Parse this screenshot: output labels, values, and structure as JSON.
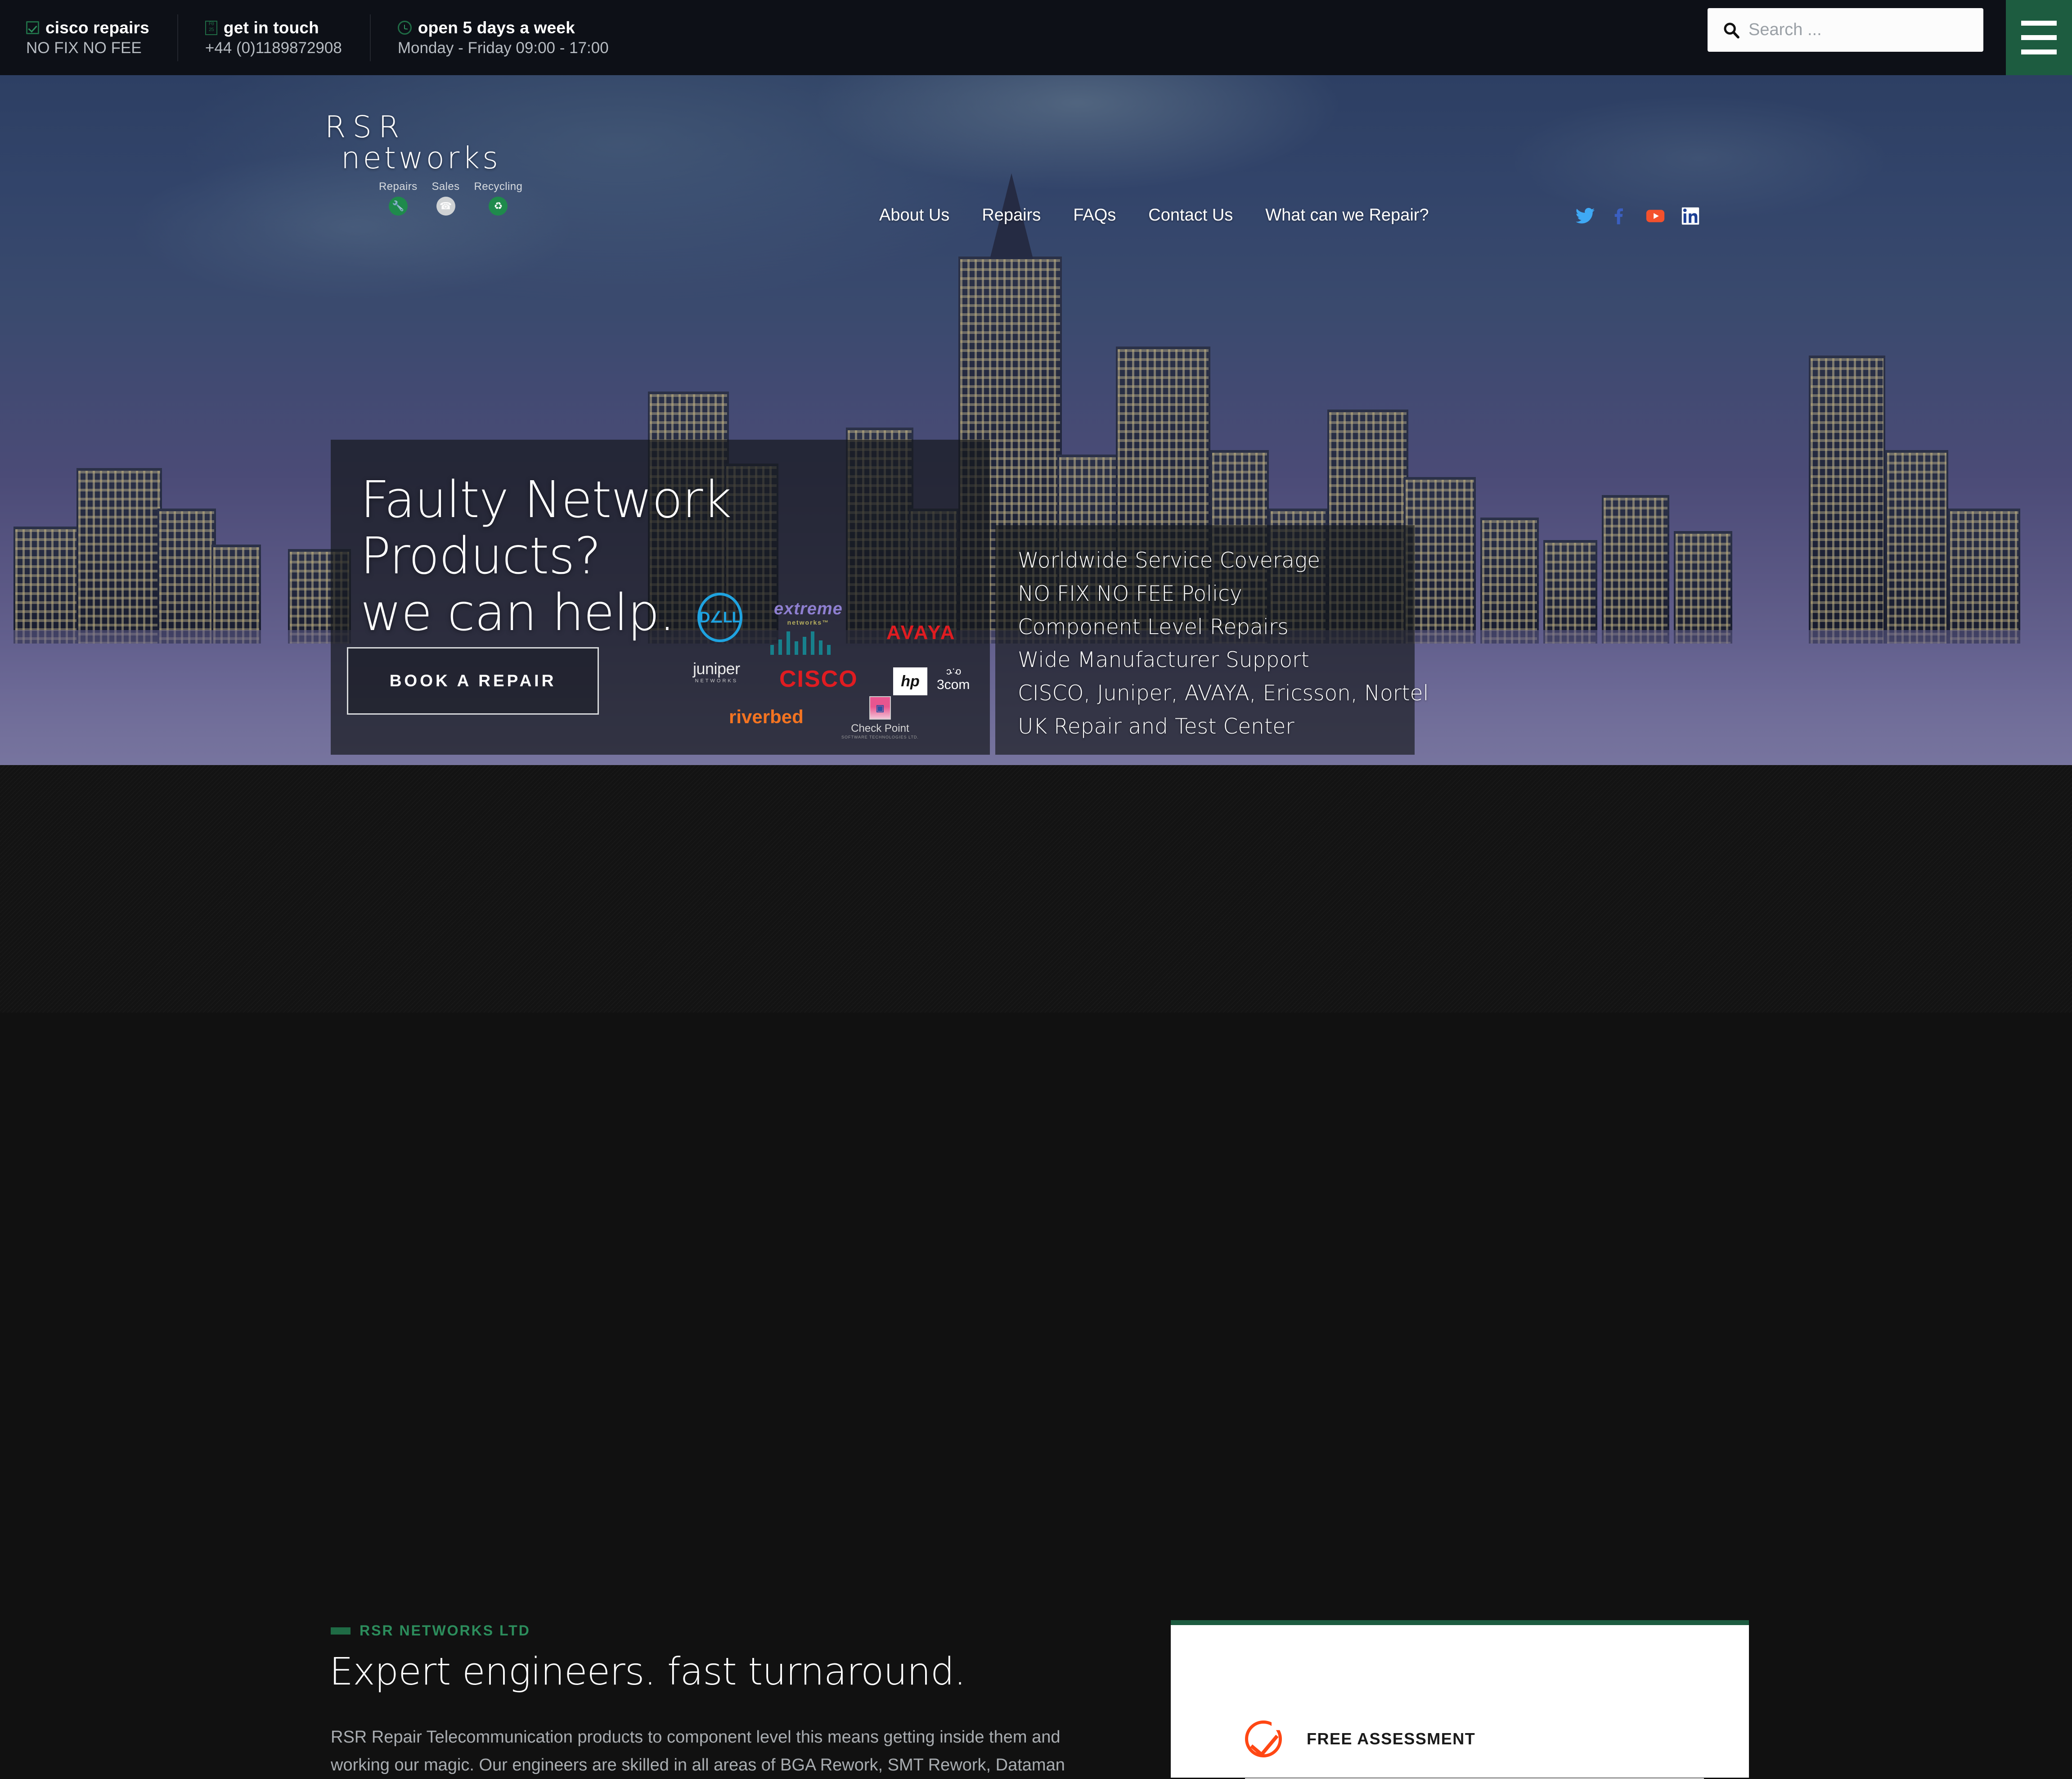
{
  "topbar": {
    "items": [
      {
        "icon": "checkbox-check-icon",
        "title": "cisco repairs",
        "sub": "NO FIX NO FEE"
      },
      {
        "icon": "missing-glyph-icon",
        "title": "get in touch",
        "sub": "+44 (0)1189872908"
      },
      {
        "icon": "clock-icon",
        "title": "open 5 days a week",
        "sub": "Monday - Friday 09:00 - 17:00"
      }
    ],
    "search": {
      "value": "",
      "placeholder": "Search ..."
    },
    "menu_icon": "hamburger-menu-icon"
  },
  "logo": {
    "line1": "RSR",
    "line2": "networks",
    "sub": [
      {
        "label": "Repairs",
        "glyph": "⚒",
        "style": "green"
      },
      {
        "label": "Sales",
        "glyph": "☎",
        "style": "grey"
      },
      {
        "label": "Recycling",
        "glyph": "♻",
        "style": "green"
      }
    ]
  },
  "nav": {
    "items": [
      {
        "label": "About Us"
      },
      {
        "label": "Repairs"
      },
      {
        "label": "FAQs"
      },
      {
        "label": "Contact Us"
      },
      {
        "label": "What can we Repair?"
      }
    ],
    "social": [
      {
        "name": "twitter-icon",
        "color": "#3fa9f5"
      },
      {
        "name": "facebook-icon",
        "color": "#3b5fc0"
      },
      {
        "name": "youtube-icon",
        "color": "#f4512c"
      },
      {
        "name": "linkedin-icon",
        "color": "#1c3f94"
      }
    ]
  },
  "hero": {
    "heading_line1": "Faulty Network Products?",
    "heading_line2": "we can help.",
    "cta_label": "BOOK A REPAIR",
    "bullets": [
      "Worldwide Service Coverage",
      "NO FIX NO FEE Policy",
      "Component Level Repairs",
      "Wide Manufacturer Support",
      "CISCO, Juniper, AVAYA, Ericsson, Nortel",
      "UK Repair and Test Center"
    ],
    "brands": [
      {
        "name": "dell-logo",
        "text": "D∠LL"
      },
      {
        "name": "extreme-networks-logo",
        "text": "extreme",
        "sub": "networks™"
      },
      {
        "name": "avaya-logo",
        "text": "AVAYA"
      },
      {
        "name": "juniper-logo",
        "text": "juniper",
        "sub": "NETWORKS"
      },
      {
        "name": "cisco-logo",
        "text": "CISCO"
      },
      {
        "name": "hp-logo",
        "text": "hp"
      },
      {
        "name": "3com-logo",
        "text": "3com",
        "sub": "ɔ∴ο"
      },
      {
        "name": "riverbed-logo",
        "text": "riverbed"
      },
      {
        "name": "checkpoint-logo",
        "text": "Check Point",
        "sub": "SOFTWARE TECHNOLOGIES LTD."
      }
    ],
    "carousel": {
      "slides": 3,
      "active": 0
    }
  },
  "lower": {
    "eyebrow": "RSR NETWORKS LTD",
    "heading": "Expert engineers. fast turnaround.",
    "paragraph": "RSR Repair Telecommunication products to component level this means getting inside them and working our magic. Our engineers are skilled in all areas of BGA Rework, SMT Rework, Dataman",
    "card": {
      "icon": "circle-check-icon",
      "label": "FREE ASSESSMENT"
    }
  },
  "colors": {
    "brand_green": "#1d5c40",
    "accent_green": "#2c8d5c",
    "orange": "#ff4714",
    "topbar_bg": "#0d1017"
  }
}
